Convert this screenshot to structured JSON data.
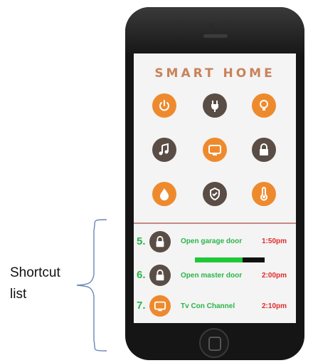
{
  "annotation": {
    "line1": "Shortcut",
    "line2": "list"
  },
  "app": {
    "title": "SMART HOME"
  },
  "icons": [
    {
      "name": "power-icon",
      "color": "#ee8a2e"
    },
    {
      "name": "plug-icon",
      "color": "#5a4d46"
    },
    {
      "name": "lightbulb-icon",
      "color": "#ee8a2e"
    },
    {
      "name": "music-icon",
      "color": "#5a4d46"
    },
    {
      "name": "tv-icon",
      "color": "#ee8a2e"
    },
    {
      "name": "lock-icon",
      "color": "#5a4d46"
    },
    {
      "name": "water-drop-icon",
      "color": "#ee8a2e"
    },
    {
      "name": "shield-icon",
      "color": "#5a4d46"
    },
    {
      "name": "thermometer-icon",
      "color": "#ee8a2e"
    }
  ],
  "shortcuts": [
    {
      "number": "5.",
      "icon": "lock-icon",
      "label": "Open garage door",
      "time": "1:50pm",
      "progress": 0.68
    },
    {
      "number": "6.",
      "icon": "lock-icon",
      "label": "Open master door",
      "time": "2:00pm"
    },
    {
      "number": "7.",
      "icon": "tv-icon",
      "label": "Tv Con Channel",
      "time": "2:10pm"
    }
  ],
  "colors": {
    "accent_orange": "#ee8a2e",
    "dark_icon": "#5a4d46",
    "green_text": "#2bb54a",
    "red_time": "#e02b2b",
    "title": "#c9825a"
  }
}
